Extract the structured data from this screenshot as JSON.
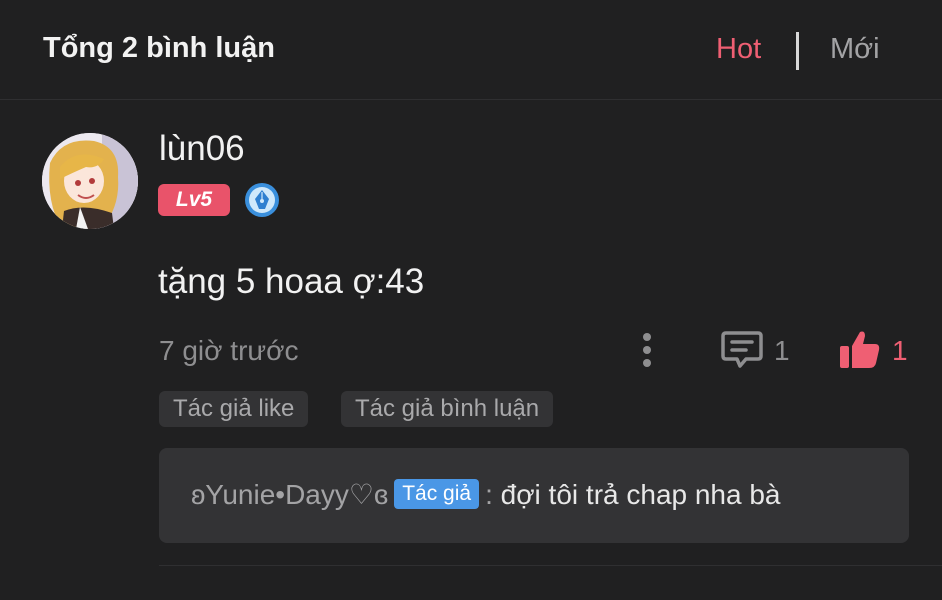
{
  "header": {
    "title": "Tổng 2 bình luận",
    "sort_hot": "Hot",
    "sort_new": "Mới"
  },
  "comment": {
    "username": "lùn06",
    "level": "Lv5",
    "text": "tặng 5 hoaa ợ:43",
    "time": "7 giờ trước",
    "reply_count": "1",
    "like_count": "1",
    "tags": [
      "Tác giả like",
      "Tác giả bình luận"
    ],
    "reply": {
      "author": "ʚYunie•Dayy♡ɞ",
      "badge": "Tác giả",
      "separator": ":",
      "text": "đợi tôi trả chap nha bà"
    }
  },
  "colors": {
    "background": "#202021",
    "accent_pink": "#ef5f73",
    "level_badge": "#e9536a",
    "author_badge": "#4a97e6"
  },
  "icons": {
    "more": "more-vertical-icon",
    "reply": "comment-icon",
    "like": "thumbs-up-icon",
    "badge": "pen-nib-badge-icon"
  }
}
